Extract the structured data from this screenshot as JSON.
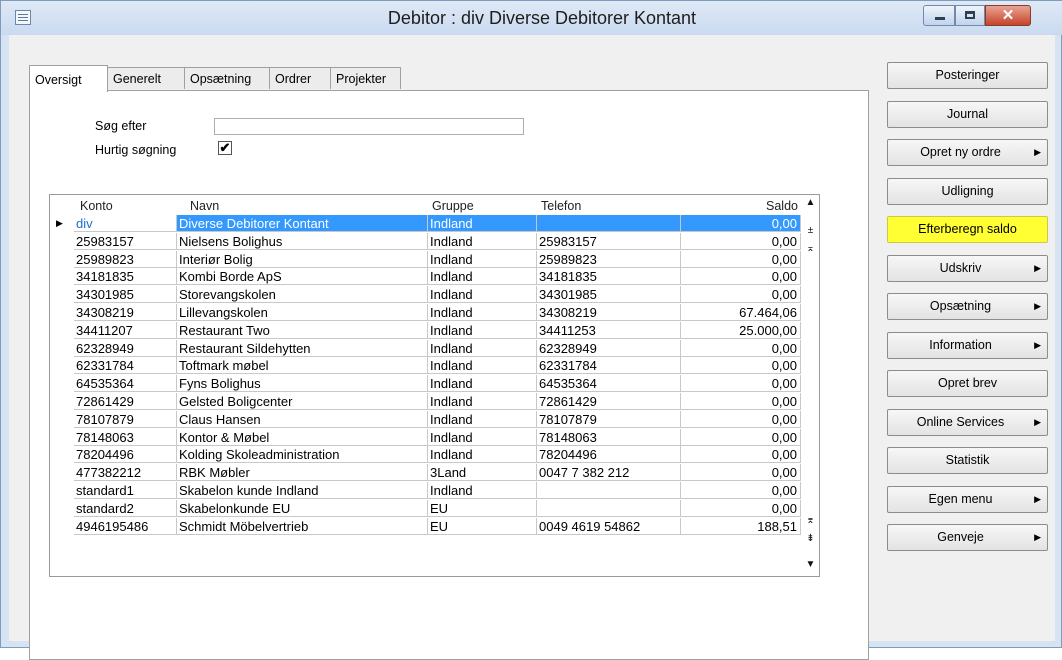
{
  "window": {
    "title": "Debitor : div   Diverse Debitorer Kontant",
    "close_glyph": "✕"
  },
  "tabs": [
    {
      "label": "Oversigt",
      "active": true
    },
    {
      "label": "Generelt",
      "active": false
    },
    {
      "label": "Opsætning",
      "active": false
    },
    {
      "label": "Ordrer",
      "active": false
    },
    {
      "label": "Projekter",
      "active": false
    }
  ],
  "search": {
    "label": "Søg efter",
    "value": "",
    "fast_label": "Hurtig søgning",
    "fast_checked": true,
    "check_glyph": "✔"
  },
  "grid": {
    "columns": [
      "Konto",
      "Navn",
      "Gruppe",
      "Telefon",
      "Saldo"
    ],
    "row_indicator": "▶",
    "rows": [
      {
        "konto": "div",
        "navn": "Diverse Debitorer Kontant",
        "gruppe": "Indland",
        "telefon": "",
        "saldo": "0,00",
        "selected": true
      },
      {
        "konto": "25983157",
        "navn": "Nielsens Bolighus",
        "gruppe": "Indland",
        "telefon": "25983157",
        "saldo": "0,00"
      },
      {
        "konto": "25989823",
        "navn": "Interiør Bolig",
        "gruppe": "Indland",
        "telefon": "25989823",
        "saldo": "0,00"
      },
      {
        "konto": "34181835",
        "navn": "Kombi Borde ApS",
        "gruppe": "Indland",
        "telefon": "34181835",
        "saldo": "0,00"
      },
      {
        "konto": "34301985",
        "navn": "Storevangskolen",
        "gruppe": "Indland",
        "telefon": "34301985",
        "saldo": "0,00"
      },
      {
        "konto": "34308219",
        "navn": "Lillevangskolen",
        "gruppe": "Indland",
        "telefon": "34308219",
        "saldo": "67.464,06"
      },
      {
        "konto": "34411207",
        "navn": "Restaurant Two",
        "gruppe": "Indland",
        "telefon": "34411253",
        "saldo": "25.000,00"
      },
      {
        "konto": "62328949",
        "navn": "Restaurant Sildehytten",
        "gruppe": "Indland",
        "telefon": "62328949",
        "saldo": "0,00"
      },
      {
        "konto": "62331784",
        "navn": "Toftmark møbel",
        "gruppe": "Indland",
        "telefon": "62331784",
        "saldo": "0,00"
      },
      {
        "konto": "64535364",
        "navn": "Fyns Bolighus",
        "gruppe": "Indland",
        "telefon": "64535364",
        "saldo": "0,00"
      },
      {
        "konto": "72861429",
        "navn": "Gelsted Boligcenter",
        "gruppe": "Indland",
        "telefon": "72861429",
        "saldo": "0,00"
      },
      {
        "konto": "78107879",
        "navn": "Claus Hansen",
        "gruppe": "Indland",
        "telefon": "78107879",
        "saldo": "0,00"
      },
      {
        "konto": "78148063",
        "navn": "Kontor & Møbel",
        "gruppe": "Indland",
        "telefon": "78148063",
        "saldo": "0,00"
      },
      {
        "konto": "78204496",
        "navn": "Kolding Skoleadministration",
        "gruppe": "Indland",
        "telefon": "78204496",
        "saldo": "0,00"
      },
      {
        "konto": "477382212",
        "navn": "RBK  Møbler",
        "gruppe": "3Land",
        "telefon": "0047 7 382 212",
        "saldo": "0,00"
      },
      {
        "konto": "standard1",
        "navn": "Skabelon kunde Indland",
        "gruppe": "Indland",
        "telefon": "",
        "saldo": "0,00"
      },
      {
        "konto": "standard2",
        "navn": "Skabelonkunde EU",
        "gruppe": "EU",
        "telefon": "",
        "saldo": "0,00"
      },
      {
        "konto": "4946195486",
        "navn": "Schmidt Möbelvertrieb",
        "gruppe": "EU",
        "telefon": "0049 4619 54862",
        "saldo": "188,51"
      }
    ]
  },
  "sidebar": {
    "buttons": [
      {
        "name": "posteringer-button",
        "label": "Posteringer",
        "arrow": false,
        "highlighted": false
      },
      {
        "name": "journal-button",
        "label": "Journal",
        "arrow": false,
        "highlighted": false
      },
      {
        "name": "opret-ny-ordre-button",
        "label": "Opret ny ordre",
        "arrow": true,
        "highlighted": false
      },
      {
        "name": "udligning-button",
        "label": "Udligning",
        "arrow": false,
        "highlighted": false
      },
      {
        "name": "efterberegn-saldo-button",
        "label": "Efterberegn saldo",
        "arrow": false,
        "highlighted": true
      },
      {
        "name": "udskriv-button",
        "label": "Udskriv",
        "arrow": true,
        "highlighted": false
      },
      {
        "name": "opsaetning-button",
        "label": "Opsætning",
        "arrow": true,
        "highlighted": false
      },
      {
        "name": "information-button",
        "label": "Information",
        "arrow": true,
        "highlighted": false
      },
      {
        "name": "opret-brev-button",
        "label": "Opret brev",
        "arrow": false,
        "highlighted": false
      },
      {
        "name": "online-services-button",
        "label": "Online Services",
        "arrow": true,
        "highlighted": false
      },
      {
        "name": "statistik-button",
        "label": "Statistik",
        "arrow": false,
        "highlighted": false
      },
      {
        "name": "egen-menu-button",
        "label": "Egen menu",
        "arrow": true,
        "highlighted": false
      },
      {
        "name": "genveje-button",
        "label": "Genveje",
        "arrow": true,
        "highlighted": false
      }
    ],
    "arrow_glyph": "▶"
  },
  "scrollbar": {
    "up_glyph": "▲",
    "top_glyph": "±",
    "page_up_glyph": "⌅",
    "page_down_glyph": "⌆",
    "step_down_glyph": "⇟",
    "down_glyph": "▼"
  },
  "colors": {
    "selection": "#3399ff",
    "highlight": "#ffff33"
  }
}
